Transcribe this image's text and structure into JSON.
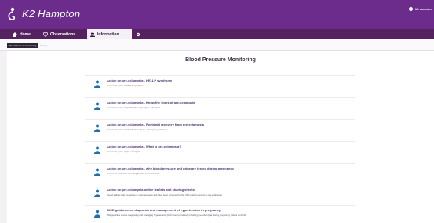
{
  "header": {
    "brand": "K2 Hampton",
    "account": "Mr Account"
  },
  "nav": {
    "tabs": [
      {
        "label": "Home",
        "icon": "home-icon",
        "active": false
      },
      {
        "label": "Observations",
        "icon": "heart-icon",
        "active": false
      },
      {
        "label": "Information",
        "icon": "people-icon",
        "active": true
      },
      {
        "label": "",
        "icon": "gear-icon",
        "active": false
      }
    ]
  },
  "breadcrumb": {
    "active": "Blood Pressure Monitoring",
    "next": "Library"
  },
  "page": {
    "title": "Blood Pressure Monitoring",
    "items": [
      {
        "title": "Action on pre-eclampsia - HELLP syndrome",
        "desc": "A women's guide to HELLP syndrome"
      },
      {
        "title": "Action on pre-eclampsia - Know the signs of pre-eclampsia",
        "desc": "A women's guide to spotting the signs of pre-eclampsia"
      },
      {
        "title": "Action on pre-eclampsia - Postnatal recovery from pre-eclampsia",
        "desc": "A women's guide and family through pre-eclampsia postnatally"
      },
      {
        "title": "Action on pre-eclampsia - What is pre-eclampsia?",
        "desc": "A women's guide to pre-eclampsia"
      },
      {
        "title": "Action on pre-eclampsia - why blood pressure and urine are tested during pregnancy",
        "desc": "A women's leaflet for attending the first antenatal visit"
      },
      {
        "title": "Action on pre-eclampsia online leaflets and sharing sheets",
        "desc": "Useful leaflets that are written in clear language and have been approved by the UK's leading experts in pre-eclampsia"
      },
      {
        "title": "NICE guidance on diagnosis and management of hypertension in pregnancy",
        "desc": "This guideline covers diagnosing and managing hypertension (high blood pressure), including pre-eclampsia, during pregnancy, labour and birth"
      }
    ]
  },
  "colors": {
    "header_bg": "#6b2c8c",
    "nav_bg": "#53225f",
    "title_text": "#3a2d46",
    "link_text": "#4b3370",
    "icon_blue": "#1f6fae"
  }
}
